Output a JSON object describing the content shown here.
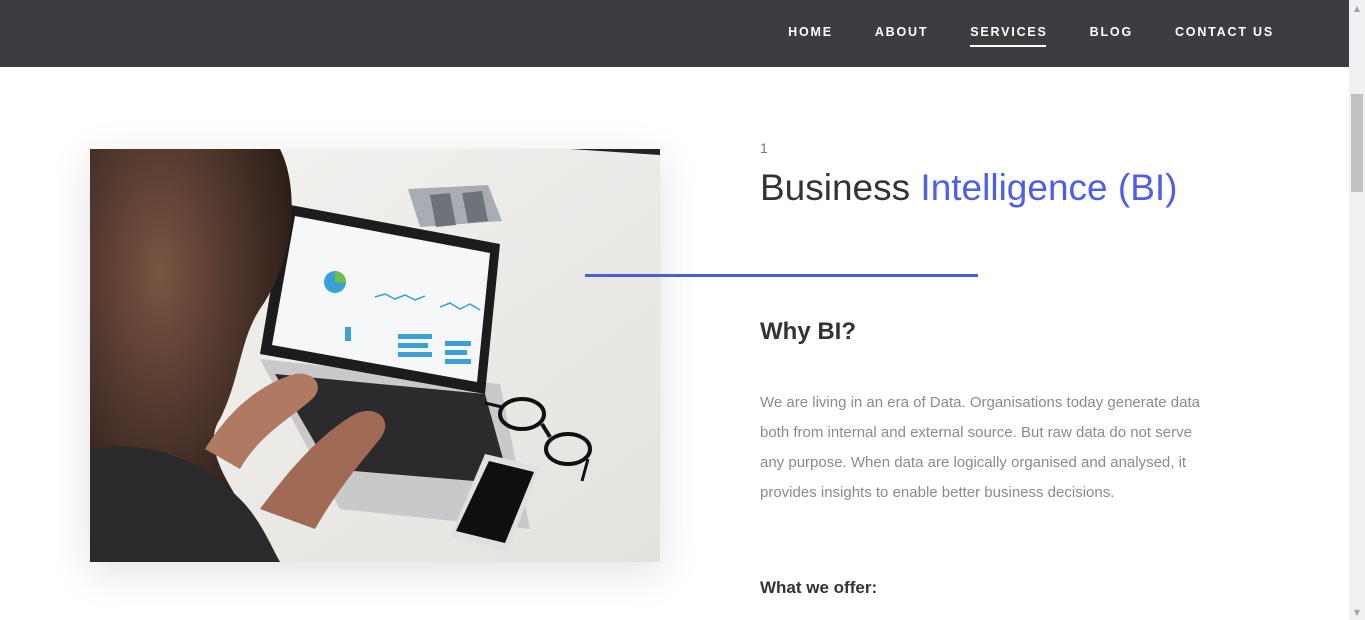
{
  "nav": {
    "items": [
      {
        "label": "HOME"
      },
      {
        "label": "ABOUT"
      },
      {
        "label": "SERVICES",
        "active": true
      },
      {
        "label": "BLOG"
      },
      {
        "label": "CONTACT US"
      }
    ]
  },
  "section": {
    "number": "1",
    "title_main": "Business ",
    "title_highlight": "Intelligence (BI)",
    "why_heading": "Why BI?",
    "paragraph": "We are living in an era of Data. Organisations today generate data both from internal and external source. But raw data do not serve any purpose. When data are logically organised and analysed, it provides insights to enable better business decisions.",
    "offer_heading": "What we offer:"
  },
  "colors": {
    "navbar": "#3d3c41",
    "accent": "#4f5ee6",
    "text_dark": "#333333",
    "text_muted": "#8b8b8b"
  },
  "icons": {
    "scroll_up": "scroll-up-arrow-icon",
    "scroll_down": "scroll-down-arrow-icon"
  }
}
